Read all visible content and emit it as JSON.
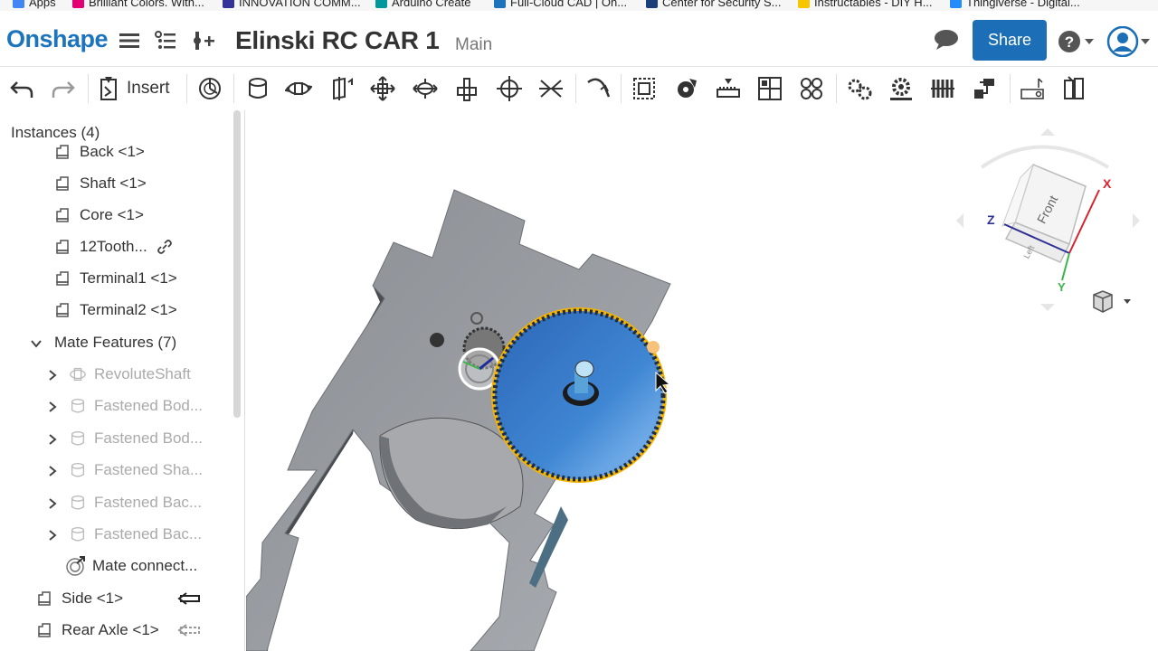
{
  "bookmarks": [
    {
      "label": "Apps",
      "color": "#4285f4"
    },
    {
      "label": "Brilliant Colors. With...",
      "color": "#e20074"
    },
    {
      "label": "INNOVATION COMM...",
      "color": "#333399"
    },
    {
      "label": "Arduino Create",
      "color": "#00979d"
    },
    {
      "label": "Full-Cloud CAD | On...",
      "color": "#1c75bc"
    },
    {
      "label": "Center for Security S...",
      "color": "#1a3e7a"
    },
    {
      "label": "Instructables - DIY H...",
      "color": "#f7c600"
    },
    {
      "label": "Thingiverse - Digital...",
      "color": "#248bfb"
    }
  ],
  "header": {
    "logo": "Onshape",
    "title": "Elinski RC CAR 1",
    "branch": "Main",
    "share_label": "Share"
  },
  "toolbar": {
    "insert_label": "Insert"
  },
  "sidebar": {
    "title": "Instances (4)",
    "items": [
      {
        "label": "Back <1>",
        "level": 2,
        "dim": false,
        "icon": "part-instance-icon"
      },
      {
        "label": "Shaft <1>",
        "level": 2,
        "dim": false,
        "icon": "part-instance-icon"
      },
      {
        "label": "Core <1>",
        "level": 2,
        "dim": false,
        "icon": "part-instance-icon"
      },
      {
        "label": "12Tooth...",
        "level": 2,
        "dim": false,
        "icon": "part-instance-icon",
        "linked": true
      },
      {
        "label": "Terminal1 <1>",
        "level": 2,
        "dim": false,
        "icon": "part-instance-icon"
      },
      {
        "label": "Terminal2 <1>",
        "level": 2,
        "dim": false,
        "icon": "part-instance-icon"
      },
      {
        "label": "Mate Features (7)",
        "level": 1,
        "dim": false,
        "icon": "",
        "expanded": true
      },
      {
        "label": "RevoluteShaft",
        "level": 2,
        "dim": true,
        "icon": "revolute-mate-icon",
        "collapsed": true
      },
      {
        "label": "Fastened Bod...",
        "level": 2,
        "dim": true,
        "icon": "fastened-mate-icon",
        "collapsed": true
      },
      {
        "label": "Fastened Bod...",
        "level": 2,
        "dim": true,
        "icon": "fastened-mate-icon",
        "collapsed": true
      },
      {
        "label": "Fastened Sha...",
        "level": 2,
        "dim": true,
        "icon": "fastened-mate-icon",
        "collapsed": true
      },
      {
        "label": "Fastened Bac...",
        "level": 2,
        "dim": true,
        "icon": "fastened-mate-icon",
        "collapsed": true
      },
      {
        "label": "Fastened Bac...",
        "level": 2,
        "dim": true,
        "icon": "fastened-mate-icon",
        "collapsed": true
      },
      {
        "label": "Mate connect...",
        "level": 2,
        "dim": false,
        "icon": "mate-connector-icon"
      },
      {
        "label": "Side <1>",
        "level": 1,
        "dim": false,
        "icon": "part-instance-icon",
        "arrow": "solid"
      },
      {
        "label": "Rear Axle <1>",
        "level": 1,
        "dim": false,
        "icon": "part-instance-icon",
        "arrow": "dashed"
      }
    ]
  },
  "navcube": {
    "front_label": "Front",
    "bottom_label": "Left",
    "x_label": "X",
    "y_label": "Y",
    "z_label": "Z",
    "x_color": "#d9232e",
    "y_color": "#39b54a",
    "z_color": "#2e3192"
  },
  "colors": {
    "brand": "#1c75bc",
    "gear_blue": "#3a7fd0",
    "gear_highlight": "#f5b400",
    "plate": "#9a9ea3"
  }
}
